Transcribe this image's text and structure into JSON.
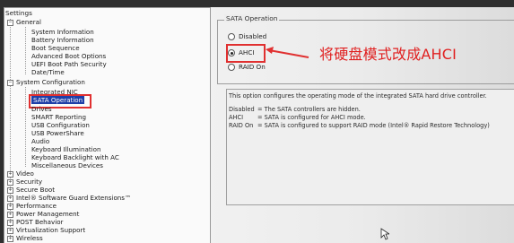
{
  "tree": {
    "title": "Settings",
    "general": {
      "label": "General",
      "items": [
        "System Information",
        "Battery Information",
        "Boot Sequence",
        "Advanced Boot Options",
        "UEFI Boot Path Security",
        "Date/Time"
      ]
    },
    "system_config": {
      "label": "System Configuration",
      "items": [
        "Integrated NIC",
        "SATA Operation",
        "Drives",
        "SMART Reporting",
        "USB Configuration",
        "USB PowerShare",
        "Audio",
        "Keyboard Illumination",
        "Keyboard Backlight with AC",
        "Miscellaneous Devices"
      ],
      "selected": "SATA Operation"
    },
    "collapsed": [
      "Video",
      "Security",
      "Secure Boot",
      "Intel® Software Guard Extensions™",
      "Performance",
      "Power Management",
      "POST Behavior",
      "Virtualization Support",
      "Wireless"
    ],
    "expand_symbol": "+",
    "collapse_symbol": "−"
  },
  "sata": {
    "group_title": "SATA Operation",
    "options": [
      "Disabled",
      "AHCI",
      "RAID On"
    ],
    "selected": "AHCI",
    "annotation": "将硬盘模式改成AHCI",
    "description": "This option configures the operating mode of the integrated SATA hard drive controller.",
    "modes": [
      {
        "name": "Disabled",
        "text": "= The SATA controllers are hidden."
      },
      {
        "name": "AHCI",
        "text": "= SATA is configured for AHCI mode."
      },
      {
        "name": "RAID On",
        "text": "= SATA is configured to support RAID mode (Intel® Rapid Restore Technology)"
      }
    ]
  },
  "colors": {
    "selection": "#1f3fa8",
    "annotation_red": "#e02020"
  }
}
